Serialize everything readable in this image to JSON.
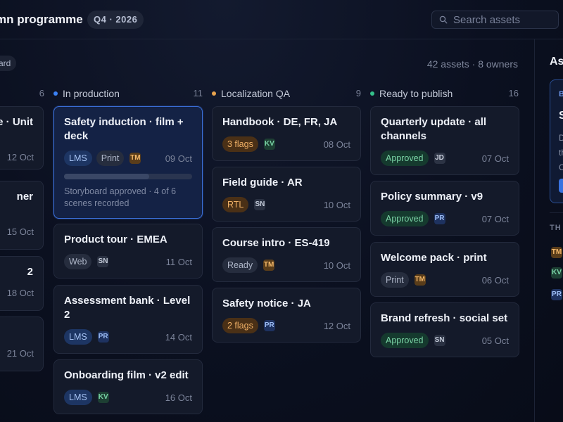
{
  "header": {
    "title": "mn programme",
    "quarter": "Q4 · 2026",
    "search_placeholder": "Search assets"
  },
  "board": {
    "pill": "ard",
    "summary": "42 assets · 8 owners"
  },
  "colors": {
    "in_production": "#3b82f6",
    "localization_qa": "#e8a34e",
    "ready_to_publish": "#34c08a"
  },
  "columns": {
    "prev": {
      "count": "6",
      "cards": [
        {
          "title": "e · Unit",
          "date": "12 Oct"
        },
        {
          "title": "ner",
          "date": "15 Oct"
        },
        {
          "title": "2",
          "date": "18 Oct"
        },
        {
          "title": "",
          "date": "21 Oct"
        }
      ]
    },
    "in_production": {
      "name": "In production",
      "count": "11",
      "cards": [
        {
          "title": "Safety induction · film + deck",
          "tags": [
            "LMS",
            "Print"
          ],
          "owner": "TM",
          "date": "09 Oct",
          "progress": 0.667,
          "note": "Storyboard approved · 4 of 6 scenes recorded"
        },
        {
          "title": "Product tour · EMEA",
          "tags": [
            "Web"
          ],
          "owner": "SN",
          "date": "11 Oct"
        },
        {
          "title": "Assessment bank · Level 2",
          "tags": [
            "LMS"
          ],
          "owner": "PR",
          "date": "14 Oct"
        },
        {
          "title": "Onboarding film · v2 edit",
          "tags": [
            "LMS"
          ],
          "owner": "KV",
          "date": "16 Oct"
        }
      ]
    },
    "localization_qa": {
      "name": "Localization QA",
      "count": "9",
      "cards": [
        {
          "title": "Handbook · DE, FR, JA",
          "tags": [
            "3 flags"
          ],
          "owner": "KV",
          "date": "08 Oct"
        },
        {
          "title": "Field guide · AR",
          "tags": [
            "RTL"
          ],
          "owner": "SN",
          "date": "10 Oct"
        },
        {
          "title": "Course intro · ES-419",
          "tags": [
            "Ready"
          ],
          "owner": "TM",
          "date": "10 Oct"
        },
        {
          "title": "Safety notice · JA",
          "tags": [
            "2 flags"
          ],
          "owner": "PR",
          "date": "12 Oct"
        }
      ]
    },
    "ready_to_publish": {
      "name": "Ready to publish",
      "count": "16",
      "cards": [
        {
          "title": "Quarterly update · all channels",
          "tags": [
            "Approved"
          ],
          "owner": "JD",
          "date": "07 Oct"
        },
        {
          "title": "Policy summary · v9",
          "tags": [
            "Approved"
          ],
          "owner": "PR",
          "date": "07 Oct"
        },
        {
          "title": "Welcome pack · print",
          "tags": [
            "Print"
          ],
          "owner": "TM",
          "date": "06 Oct"
        },
        {
          "title": "Brand refresh · social set",
          "tags": [
            "Approved"
          ],
          "owner": "SN",
          "date": "05 Oct"
        }
      ]
    }
  },
  "side_panel": {
    "title": "As",
    "card_label": "B",
    "card_heading": "S",
    "card_lines": [
      "D",
      "th",
      "C"
    ],
    "section": "TH",
    "owners": [
      "TM",
      "KV",
      "PR"
    ]
  }
}
